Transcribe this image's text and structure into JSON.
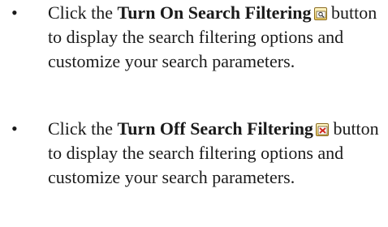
{
  "items": [
    {
      "bullet": "•",
      "before": "Click the ",
      "button_name": "Turn On Search Filtering",
      "icon": "search-filter-on-icon",
      "after": " button to display the search filtering options and customize your search parameters."
    },
    {
      "bullet": "•",
      "before": "Click the ",
      "button_name": "Turn Off Search Filtering",
      "icon": "search-filter-off-icon",
      "after": " button to display the search filtering options and customize your search parameters."
    }
  ],
  "colors": {
    "text": "#1a1a1a",
    "icon_border": "#8a6a1e",
    "icon_fill": "#f2cf63",
    "off_icon_x": "#d0281e"
  }
}
